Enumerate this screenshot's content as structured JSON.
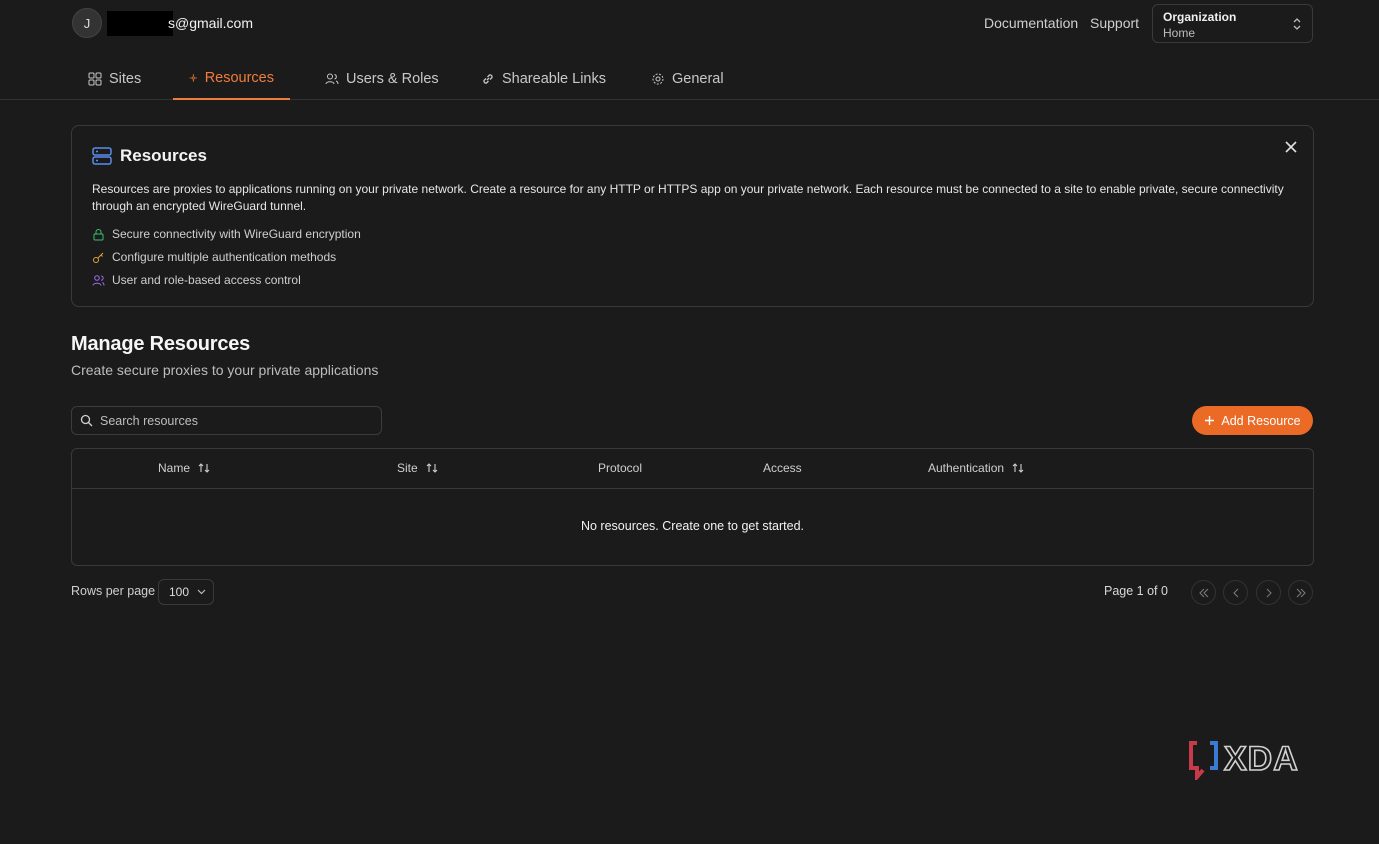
{
  "user": {
    "avatar_initial": "J",
    "email": "s@gmail.com"
  },
  "header_links": {
    "documentation": "Documentation",
    "support": "Support"
  },
  "org_selector": {
    "label": "Organization",
    "value": "Home"
  },
  "tabs": [
    {
      "label": "Sites",
      "icon": "sites-icon"
    },
    {
      "label": "Resources",
      "icon": "resources-icon",
      "active": true
    },
    {
      "label": "Users & Roles",
      "icon": "users-icon"
    },
    {
      "label": "Shareable Links",
      "icon": "link-icon"
    },
    {
      "label": "General",
      "icon": "gear-icon"
    }
  ],
  "info_card": {
    "title": "Resources",
    "description": "Resources are proxies to applications running on your private network. Create a resource for any HTTP or HTTPS app on your private network. Each resource must be connected to a site to enable private, secure connectivity through an encrypted WireGuard tunnel.",
    "features": [
      {
        "text": "Secure connectivity with WireGuard encryption",
        "icon": "lock-icon"
      },
      {
        "text": "Configure multiple authentication methods",
        "icon": "key-icon"
      },
      {
        "text": "User and role-based access control",
        "icon": "users-icon"
      }
    ]
  },
  "manage": {
    "title": "Manage Resources",
    "subtitle": "Create secure proxies to your private applications",
    "search_placeholder": "Search resources",
    "add_button": "Add Resource"
  },
  "table": {
    "columns": [
      "Name",
      "Site",
      "Protocol",
      "Access",
      "Authentication"
    ],
    "empty_message": "No resources. Create one to get started."
  },
  "pagination": {
    "rows_per_page_label": "Rows per page",
    "rows_per_page_value": "100",
    "page_info": "Page 1 of 0"
  },
  "watermark": {
    "text": "XDA"
  },
  "colors": {
    "accent": "#ea6a26",
    "active_tab": "#f07c3b",
    "background": "#1b1b1b",
    "border": "#3a3a3a"
  }
}
